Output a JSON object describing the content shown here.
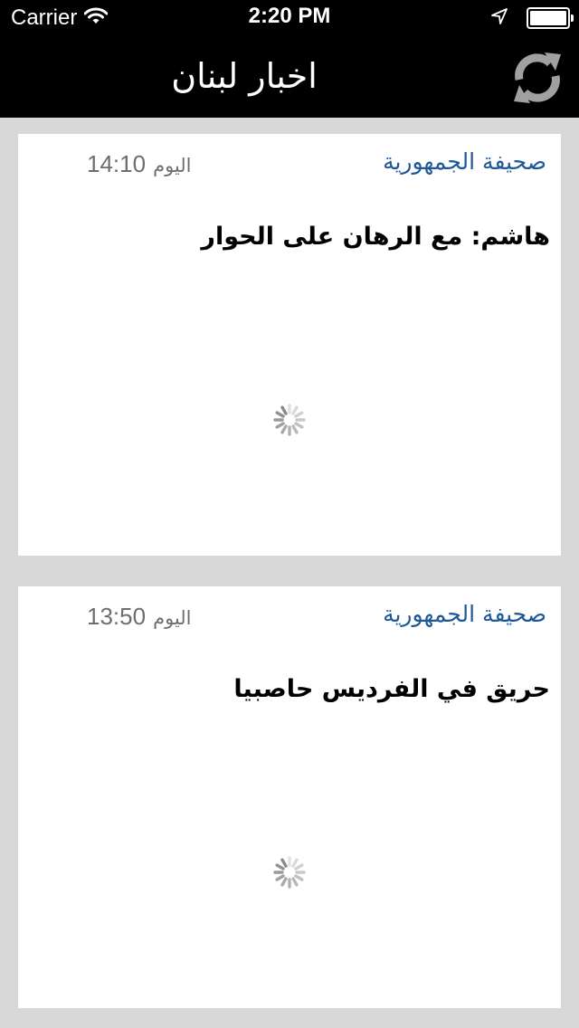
{
  "status_bar": {
    "carrier": "Carrier",
    "time": "2:20 PM",
    "battery_level": 1.0
  },
  "nav": {
    "title": "اخبار لبنان",
    "refresh_icon": "refresh-icon"
  },
  "articles": [
    {
      "source": "صحيفة الجمهورية",
      "time_label": "اليوم",
      "time": "14:10",
      "headline": "هاشم: مع الرهان على الحوار",
      "image_state": "loading"
    },
    {
      "source": "صحيفة الجمهورية",
      "time_label": "اليوم",
      "time": "13:50",
      "headline": "حريق في الفرديس حاصبيا",
      "image_state": "loading"
    }
  ],
  "colors": {
    "bar_background": "#000000",
    "page_background": "#d8d8d8",
    "card_background": "#ffffff",
    "source_color": "#1e5898",
    "time_color": "#6e6e6e",
    "refresh_icon_color": "#a0a0a0"
  }
}
